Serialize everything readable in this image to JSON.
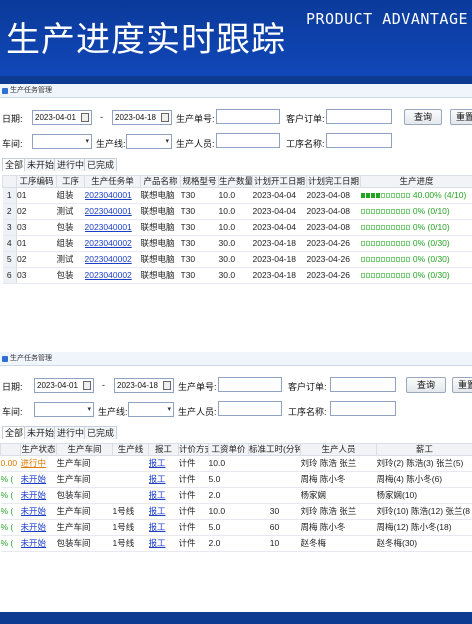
{
  "banner": {
    "title_cn": "生产进度实时跟踪",
    "title_en": "PRODUCT ADVANTAGE"
  },
  "filters": {
    "date_label": "日期:",
    "date_from": "2023-04-01",
    "date_sep": "-",
    "date_to": "2023-04-18",
    "order_no_label": "生产单号:",
    "customer_order_label": "客户订单:",
    "query_button": "查询",
    "reset_button": "重置",
    "workshop_label": "车间:",
    "line_label": "生产线:",
    "staff_label": "生产人员:",
    "process_label": "工序名称:"
  },
  "tabs": [
    "全部",
    "未开始",
    "进行中",
    "已完成"
  ],
  "panel1": {
    "title": "生产任务管理",
    "columns": [
      "工序编码",
      "工序",
      "生产任务单",
      "产品名称",
      "规格型号",
      "生产数量",
      "计划开工日期",
      "计划完工日期",
      "生产进度"
    ],
    "rows": [
      {
        "n": "1",
        "code": "01",
        "proc": "组装",
        "task": "2023040001",
        "product": "联想电脑",
        "spec": "T30",
        "qty": "10.0",
        "start": "2023-04-04",
        "end": "2023-04-08",
        "progress": "40.00% (4/10)",
        "filled": 4
      },
      {
        "n": "2",
        "code": "02",
        "proc": "测试",
        "task": "2023040001",
        "product": "联想电脑",
        "spec": "T30",
        "qty": "10.0",
        "start": "2023-04-04",
        "end": "2023-04-08",
        "progress": "0% (0/10)",
        "filled": 0
      },
      {
        "n": "3",
        "code": "03",
        "proc": "包装",
        "task": "2023040001",
        "product": "联想电脑",
        "spec": "T30",
        "qty": "10.0",
        "start": "2023-04-04",
        "end": "2023-04-08",
        "progress": "0% (0/10)",
        "filled": 0
      },
      {
        "n": "4",
        "code": "01",
        "proc": "组装",
        "task": "2023040002",
        "product": "联想电脑",
        "spec": "T30",
        "qty": "30.0",
        "start": "2023-04-18",
        "end": "2023-04-26",
        "progress": "0% (0/30)",
        "filled": 0
      },
      {
        "n": "5",
        "code": "02",
        "proc": "测试",
        "task": "2023040002",
        "product": "联想电脑",
        "spec": "T30",
        "qty": "30.0",
        "start": "2023-04-18",
        "end": "2023-04-26",
        "progress": "0% (0/30)",
        "filled": 0
      },
      {
        "n": "6",
        "code": "03",
        "proc": "包装",
        "task": "2023040002",
        "product": "联想电脑",
        "spec": "T30",
        "qty": "30.0",
        "start": "2023-04-18",
        "end": "2023-04-26",
        "progress": "0% (0/30)",
        "filled": 0
      }
    ]
  },
  "panel2": {
    "title": "生产任务管理",
    "columns": [
      "生产状态",
      "生产车间",
      "生产线",
      "报工",
      "计价方式",
      "工资单价",
      "标准工时(分钟)",
      "生产人员",
      "薪工"
    ],
    "rows": [
      {
        "pct": "0.00",
        "status": "进行中",
        "workshop": "生产车间",
        "line": "",
        "report": "报工",
        "pricing": "计件",
        "price": "10.0",
        "std": "",
        "staff": "刘玲 陈浩 张兰",
        "wage": "刘玲(2) 陈浩(3) 张兰(5)"
      },
      {
        "pct": "% (",
        "status": "未开始",
        "workshop": "生产车间",
        "line": "",
        "report": "报工",
        "pricing": "计件",
        "price": "5.0",
        "std": "",
        "staff": "周梅 陈小冬",
        "wage": "周梅(4) 陈小冬(6)"
      },
      {
        "pct": "% (",
        "status": "未开始",
        "workshop": "包装车间",
        "line": "",
        "report": "报工",
        "pricing": "计件",
        "price": "2.0",
        "std": "",
        "staff": "杨家娴",
        "wage": "杨家娴(10)"
      },
      {
        "pct": "% (",
        "status": "未开始",
        "workshop": "生产车间",
        "line": "1号线",
        "report": "报工",
        "pricing": "计件",
        "price": "10.0",
        "std": "30",
        "staff": "刘玲 陈浩 张兰",
        "wage": "刘玲(10) 陈浩(12) 张兰(8"
      },
      {
        "pct": "% (",
        "status": "未开始",
        "workshop": "生产车间",
        "line": "1号线",
        "report": "报工",
        "pricing": "计件",
        "price": "5.0",
        "std": "60",
        "staff": "周梅 陈小冬",
        "wage": "周梅(12) 陈小冬(18)"
      },
      {
        "pct": "% (",
        "status": "未开始",
        "workshop": "包装车间",
        "line": "1号线",
        "report": "报工",
        "pricing": "计件",
        "price": "2.0",
        "std": "10",
        "staff": "赵冬梅",
        "wage": "赵冬梅(30)"
      }
    ]
  },
  "colors": {
    "banner": "#0d3b91",
    "link": "#1a3ec9",
    "progress_green": "#26a226",
    "status_orange": "#e07a00"
  }
}
